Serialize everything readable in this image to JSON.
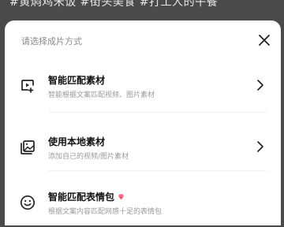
{
  "background": {
    "text": "#黄焖鸡米饭 #街头美食 #打工人的午餐"
  },
  "sheet": {
    "title": "请选择成片方式",
    "options": [
      {
        "title": "智能匹配素材",
        "desc": "智能根据文案匹配视频、图片素材",
        "icon": "video-play-icon"
      },
      {
        "title": "使用本地素材",
        "desc": "添加自己的视频/图片素材",
        "icon": "gallery-icon"
      },
      {
        "title": "智能匹配表情包",
        "desc": "根据文案内容匹配网感十足的表情包",
        "icon": "smiley-icon",
        "badge_color": "#ff4d6d"
      }
    ]
  },
  "colors": {
    "overlay": "#4a4a4a",
    "sheet": "#ffffff",
    "title_text": "#111111",
    "desc_text": "#9a9a9a"
  }
}
